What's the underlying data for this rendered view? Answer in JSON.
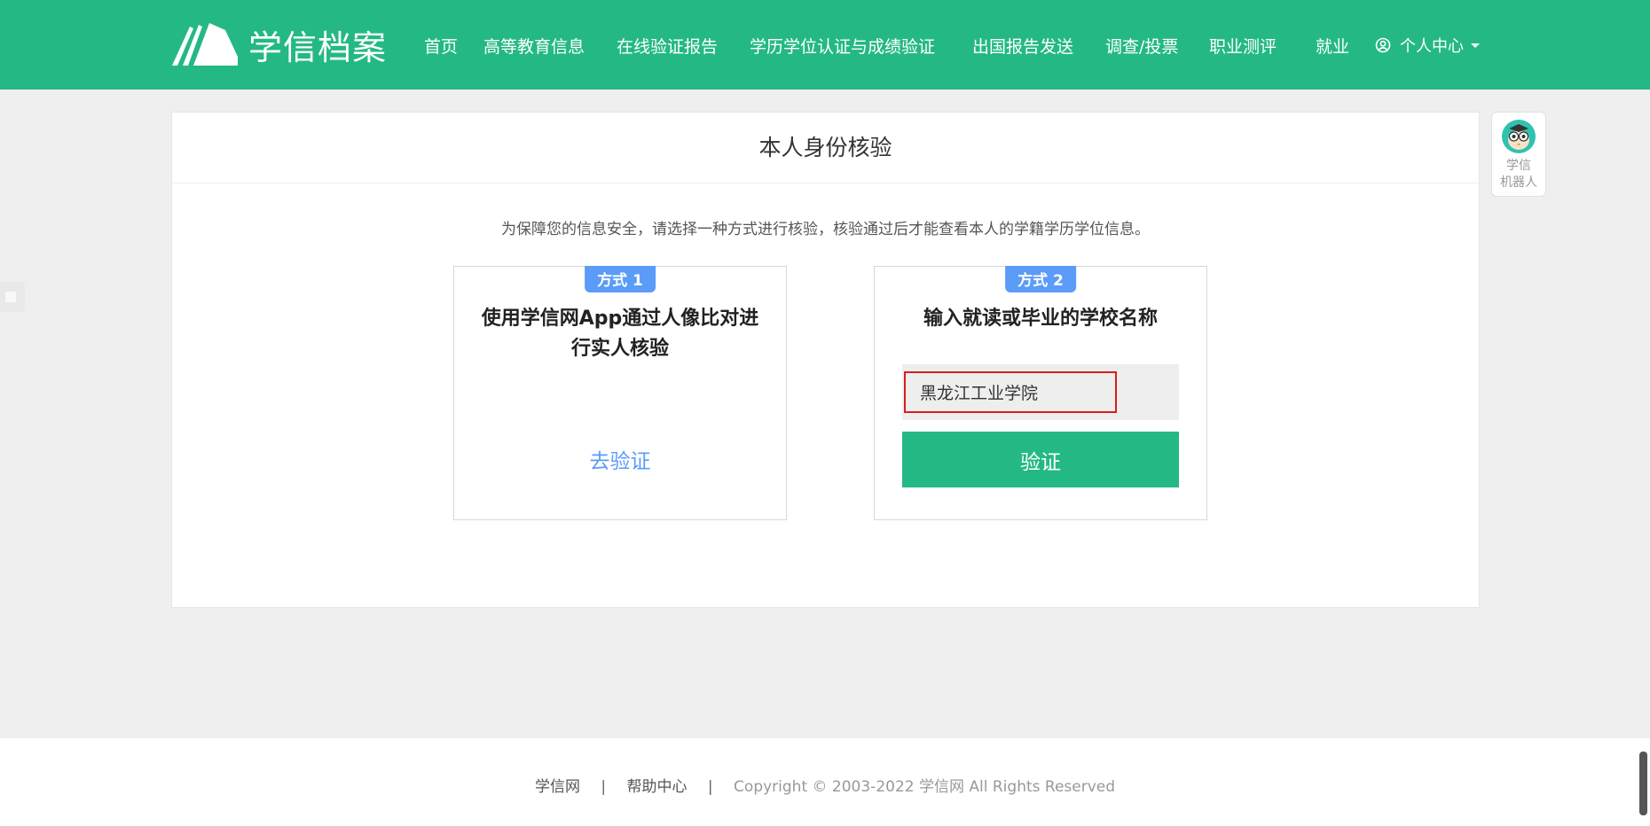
{
  "header": {
    "logo_text": "学信档案",
    "nav": [
      "首页",
      "高等教育信息",
      "在线验证报告",
      "学历学位认证与成绩验证",
      "出国报告发送",
      "调查/投票",
      "职业测评",
      "就业"
    ],
    "user_center": "个人中心"
  },
  "card": {
    "title": "本人身份核验",
    "notice": "为保障您的信息安全，请选择一种方式进行核验，核验通过后才能查看本人的学籍学历学位信息。",
    "method1": {
      "tag": "方式 1",
      "heading": "使用学信网App通过人像比对进行实人核验",
      "link": "去验证"
    },
    "method2": {
      "tag": "方式 2",
      "heading": "输入就读或毕业的学校名称",
      "input_value": "黑龙江工业学院",
      "button": "验证"
    }
  },
  "robot": {
    "label1": "学信",
    "label2": "机器人"
  },
  "footer": {
    "link1": "学信网",
    "sep": "|",
    "link2": "帮助中心",
    "copyright": "Copyright © 2003-2022 学信网 All Rights Reserved"
  },
  "colors": {
    "brand": "#24b984",
    "tag_blue": "#5a9cf8",
    "input_border": "#d81e1e"
  }
}
